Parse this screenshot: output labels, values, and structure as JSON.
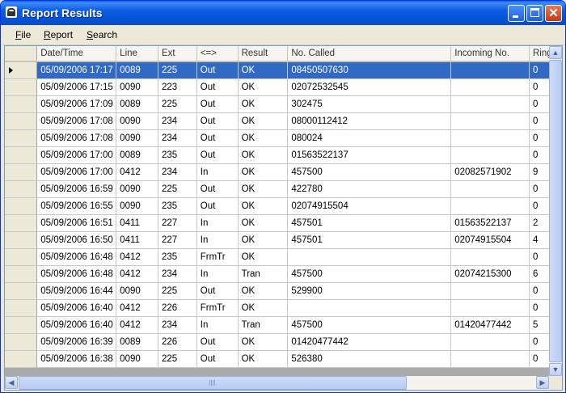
{
  "window": {
    "title": "Report Results"
  },
  "menu": [
    {
      "accel": "F",
      "rest": "ile"
    },
    {
      "accel": "R",
      "rest": "eport"
    },
    {
      "accel": "S",
      "rest": "earch"
    }
  ],
  "columns": [
    "Date/Time",
    "Line",
    "Ext",
    "<=>",
    "Result",
    "No. Called",
    "Incoming No.",
    "Rings"
  ],
  "rows": [
    [
      "05/09/2006 17:17",
      "0089",
      "225",
      "Out",
      "OK",
      "08450507630",
      "",
      "0"
    ],
    [
      "05/09/2006 17:15",
      "0090",
      "223",
      "Out",
      "OK",
      "02072532545",
      "",
      "0"
    ],
    [
      "05/09/2006 17:09",
      "0089",
      "225",
      "Out",
      "OK",
      "302475",
      "",
      "0"
    ],
    [
      "05/09/2006 17:08",
      "0090",
      "234",
      "Out",
      "OK",
      "08000112412",
      "",
      "0"
    ],
    [
      "05/09/2006 17:08",
      "0090",
      "234",
      "Out",
      "OK",
      "080024",
      "",
      "0"
    ],
    [
      "05/09/2006 17:00",
      "0089",
      "235",
      "Out",
      "OK",
      "01563522137",
      "",
      "0"
    ],
    [
      "05/09/2006 17:00",
      "0412",
      "234",
      "In",
      "OK",
      "457500",
      "02082571902",
      "9"
    ],
    [
      "05/09/2006 16:59",
      "0090",
      "225",
      "Out",
      "OK",
      "422780",
      "",
      "0"
    ],
    [
      "05/09/2006 16:55",
      "0090",
      "235",
      "Out",
      "OK",
      "02074915504",
      "",
      "0"
    ],
    [
      "05/09/2006 16:51",
      "0411",
      "227",
      "In",
      "OK",
      "457501",
      "01563522137",
      "2"
    ],
    [
      "05/09/2006 16:50",
      "0411",
      "227",
      "In",
      "OK",
      "457501",
      "02074915504",
      "4"
    ],
    [
      "05/09/2006 16:48",
      "0412",
      "235",
      "FrmTr",
      "OK",
      "",
      "",
      "0"
    ],
    [
      "05/09/2006 16:48",
      "0412",
      "234",
      "In",
      "Tran",
      "457500",
      "02074215300",
      "6"
    ],
    [
      "05/09/2006 16:44",
      "0090",
      "225",
      "Out",
      "OK",
      "529900",
      "",
      "0"
    ],
    [
      "05/09/2006 16:40",
      "0412",
      "226",
      "FrmTr",
      "OK",
      "",
      "",
      "0"
    ],
    [
      "05/09/2006 16:40",
      "0412",
      "234",
      "In",
      "Tran",
      "457500",
      "01420477442",
      "5"
    ],
    [
      "05/09/2006 16:39",
      "0089",
      "226",
      "Out",
      "OK",
      "01420477442",
      "",
      "0"
    ],
    [
      "05/09/2006 16:38",
      "0090",
      "225",
      "Out",
      "OK",
      "526380",
      "",
      "0"
    ]
  ],
  "selected_row": 0,
  "colors": {
    "selection": "#316ac5",
    "titlebar": "#0454d8",
    "window_bg": "#ece9d8"
  }
}
